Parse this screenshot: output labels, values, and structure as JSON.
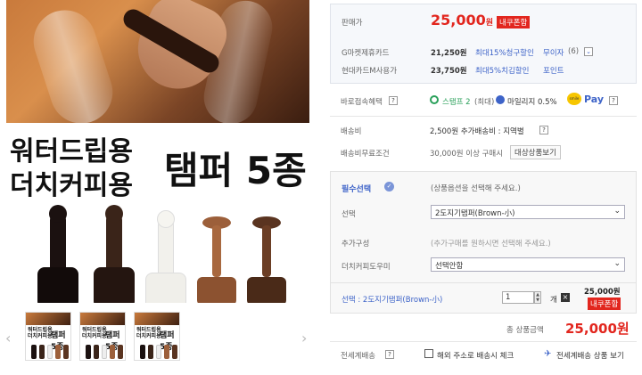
{
  "product": {
    "title_line1": "워터드립용",
    "title_line2": "더치커피용",
    "title_main": "탬퍼 5종",
    "thumb_line1": "워터드립용",
    "thumb_line2": "더치커피용",
    "thumb_main": "탬퍼 5종"
  },
  "navigation": {
    "prev_icon": "‹",
    "next_icon": "›"
  },
  "price": {
    "label": "판매가",
    "value": "25,000",
    "unit": "원",
    "coupon_badge": "내쿠폰함",
    "card1_label": "G마켓제휴카드",
    "card1_value": "21,250원",
    "card1_discount": "최대15%청구할인",
    "card1_link": "무이자",
    "card1_count": "(6)",
    "card2_label": "현대카드M사용가",
    "card2_value": "23,750원",
    "card2_discount": "최대5%치김할인",
    "card2_link": "포인트"
  },
  "benefits": {
    "label": "바로접속혜택",
    "stamp": "스탬프 2",
    "stamp_max": "(최대)",
    "mileage": "마일리지 0.5%",
    "smile": "smile",
    "pay": "Pay"
  },
  "shipping": {
    "fee_label": "배송비",
    "fee_value": "2,500원 추가배송비 : 지역별",
    "free_label": "배송비무료조건",
    "free_value": "30,000원 이상 구매시",
    "free_button": "대상상품보기"
  },
  "options": {
    "required_label": "필수선택",
    "required_hint": "(상품옵션을 선택해 주세요.)",
    "select_label": "선택",
    "select_value": "2도지기탬퍼(Brown-小)",
    "extra_label": "추가구성",
    "extra_hint": "(추가구매를 원하시면 선택해 주세요.)",
    "extra_select_label": "더치커피도우미",
    "extra_select_value": "선택안함"
  },
  "selected": {
    "label": "선택 : 2도지기탬퍼(Brown-小)",
    "qty": "1",
    "qty_unit": "개",
    "price": "25,000원",
    "coupon_badge": "내쿠폰함"
  },
  "total": {
    "label": "총 상품금액",
    "value": "25,000원"
  },
  "global": {
    "label": "전세계배송",
    "checkbox_label": "해외 주소로 배송시 체크",
    "link": "전세계배송 상품 보기"
  },
  "colors": {
    "accent_red": "#e2261e",
    "link_blue": "#3d63c8",
    "price_red": "#e2261e"
  }
}
